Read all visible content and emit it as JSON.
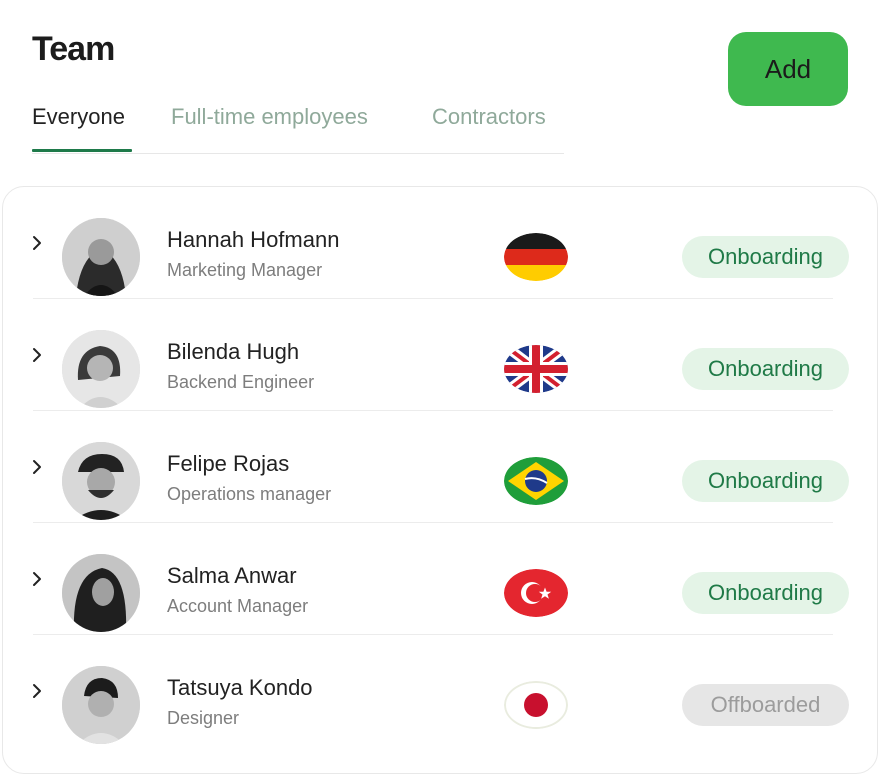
{
  "header": {
    "title": "Team",
    "add_label": "Add"
  },
  "tabs": [
    {
      "label": "Everyone",
      "active": true
    },
    {
      "label": "Full-time employees",
      "active": false
    },
    {
      "label": "Contractors",
      "active": false
    }
  ],
  "members": [
    {
      "name": "Hannah Hofmann",
      "role": "Marketing Manager",
      "flag": "germany-flag-icon",
      "status": "Onboarding"
    },
    {
      "name": "Bilenda Hugh",
      "role": "Backend Engineer",
      "flag": "uk-flag-icon",
      "status": "Onboarding"
    },
    {
      "name": "Felipe Rojas",
      "role": "Operations manager",
      "flag": "brazil-flag-icon",
      "status": "Onboarding"
    },
    {
      "name": "Salma Anwar",
      "role": "Account Manager",
      "flag": "turkey-flag-icon",
      "status": "Onboarding"
    },
    {
      "name": "Tatsuya Kondo",
      "role": "Designer",
      "flag": "japan-flag-icon",
      "status": "Offboarded"
    }
  ],
  "colors": {
    "accent": "#3fb94f",
    "tab_active_underline": "#1e7a4a",
    "onboarding_bg": "#e4f4e7",
    "onboarding_text": "#1f7a47",
    "offboarded_bg": "#e6e6e6",
    "offboarded_text": "#9c9c9c"
  }
}
